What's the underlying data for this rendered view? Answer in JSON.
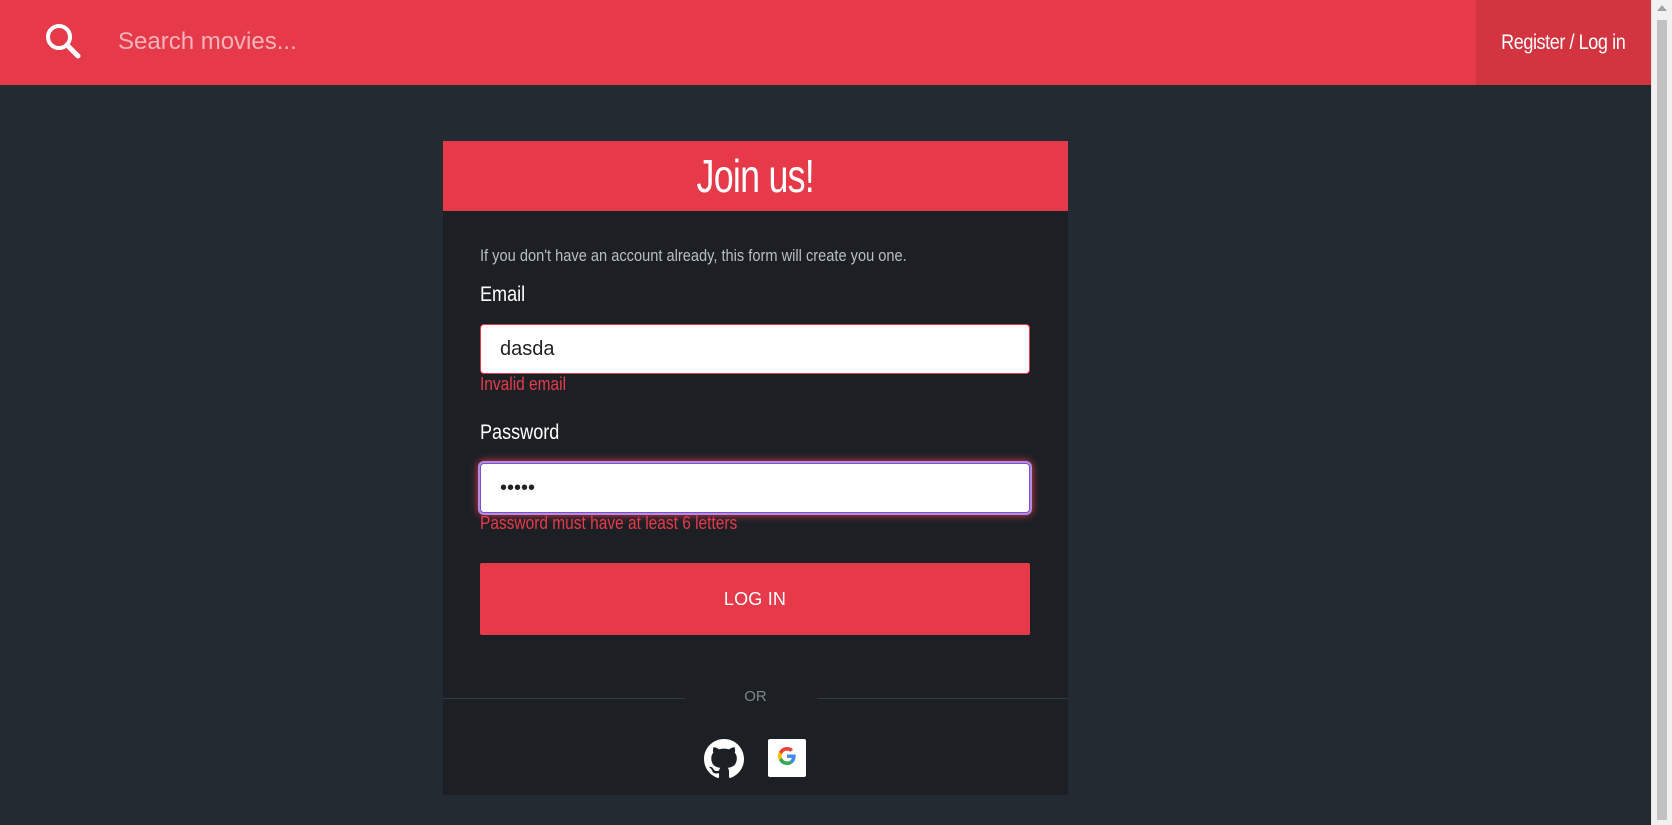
{
  "header": {
    "search_placeholder": "Search movies...",
    "auth_link": "Register / Log in"
  },
  "card": {
    "title": "Join us!",
    "intro": "If you don't have an account already, this form will create you one.",
    "email": {
      "label": "Email",
      "value": "dasda",
      "error": "Invalid email"
    },
    "password": {
      "label": "Password",
      "value": "•••••",
      "error": "Password must have at least 6 letters"
    },
    "login_button": "LOG IN",
    "divider": "OR"
  },
  "icons": {
    "search": "search-icon",
    "github": "github-icon",
    "google": "google-icon"
  },
  "colors": {
    "accent": "#e63a4a",
    "background": "#232a31",
    "card": "#1c2025"
  }
}
